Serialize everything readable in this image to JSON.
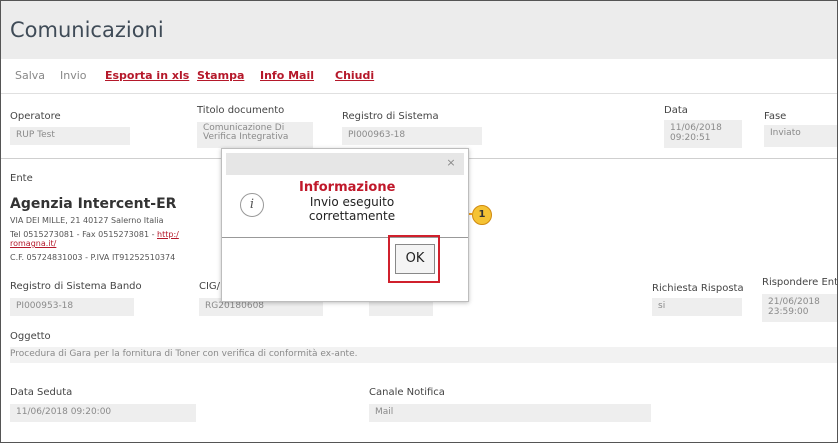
{
  "window": {
    "title": "Comunicazioni"
  },
  "toolbar": {
    "salva": "Salva",
    "invio": "Invio",
    "esporta": "Esporta in xls",
    "stampa": "Stampa",
    "info_mail": "Info Mail",
    "chiudi": "Chiudi"
  },
  "header_fields": {
    "operatore_label": "Operatore",
    "operatore_value": "RUP Test",
    "titolo_label": "Titolo documento",
    "titolo_value_line1": "Comunicazione Di",
    "titolo_value_line2": "Verifica Integrativa",
    "registro_label": "Registro di Sistema",
    "registro_value": "PI000963-18",
    "data_label": "Data",
    "data_value_line1": "11/06/2018",
    "data_value_line2": "09:20:51",
    "fase_label": "Fase",
    "fase_value": "Inviato"
  },
  "ente": {
    "label": "Ente",
    "name": "Agenzia Intercent-ER",
    "address": "VIA DEI MILLE, 21 40127 Salerno Italia",
    "tel_prefix": "Tel 0515273081 - Fax 0515273081 - ",
    "link_part1": "http:/",
    "link_part2": "romagna.it/",
    "cf": "C.F. 05724831003 - P.IVA IT91252510374"
  },
  "bando": {
    "registro_label": "Registro di Sistema Bando",
    "registro_value": "PI000953-18",
    "cig_label": "CIG/",
    "cig_value": "RG20180608",
    "richiesta_label": "Richiesta Risposta",
    "richiesta_value": "si",
    "rispondere_label": "Rispondere Entro",
    "rispondere_value_line1": "21/06/2018",
    "rispondere_value_line2": "23:59:00"
  },
  "oggetto": {
    "label": "Oggetto",
    "value": "Procedura di Gara per la fornitura di Toner con verifica di conformità ex-ante."
  },
  "seduta": {
    "data_label": "Data Seduta",
    "data_value": "11/06/2018 09:20:00",
    "canale_label": "Canale Notifica",
    "canale_value": "Mail"
  },
  "dialog": {
    "close_glyph": "×",
    "title": "Informazione",
    "message_line1": "Invio eseguito",
    "message_line2": "correttamente",
    "ok_label": "OK",
    "callout_number": "1"
  },
  "colors": {
    "accent": "#b5182a",
    "callout": "#f5c334",
    "highlight": "#d0202c"
  }
}
